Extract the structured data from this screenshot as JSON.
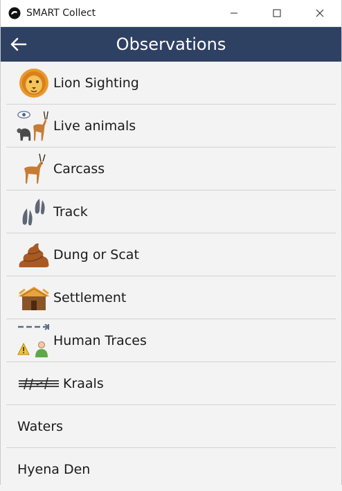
{
  "window": {
    "app_title": "SMART Collect"
  },
  "header": {
    "title": "Observations"
  },
  "items": [
    {
      "label": "Lion Sighting",
      "icon": "lion-icon"
    },
    {
      "label": "Live animals",
      "icon": "live-animals-icon"
    },
    {
      "label": "Carcass",
      "icon": "antelope-icon"
    },
    {
      "label": "Track",
      "icon": "hoof-track-icon"
    },
    {
      "label": "Dung or Scat",
      "icon": "dung-icon"
    },
    {
      "label": "Settlement",
      "icon": "hut-icon"
    },
    {
      "label": "Human Traces",
      "icon": "human-traces-icon"
    },
    {
      "label": "Kraals",
      "icon": "fence-icon"
    },
    {
      "label": "Waters",
      "icon": ""
    },
    {
      "label": "Hyena Den",
      "icon": ""
    }
  ],
  "colors": {
    "header_bg": "#2f4163",
    "list_bg": "#f3f3f3",
    "divider": "#d2d2d2"
  }
}
